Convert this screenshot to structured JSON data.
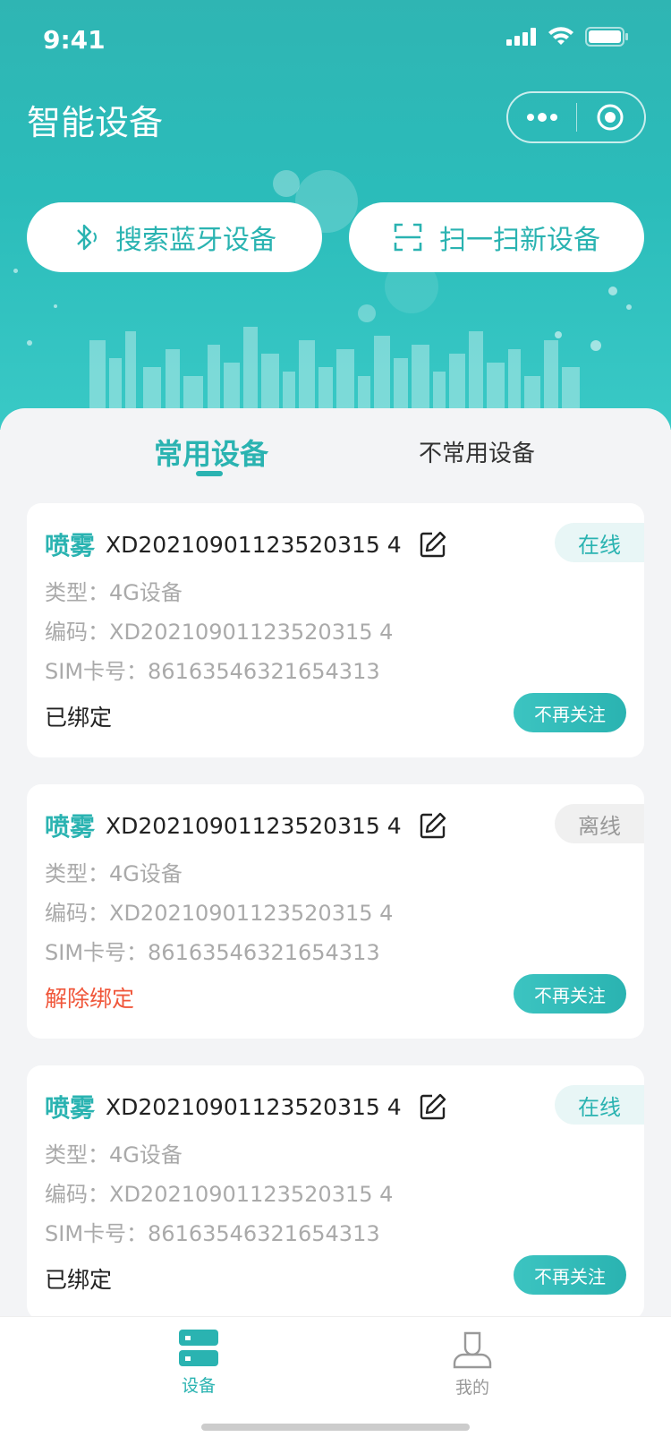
{
  "status_bar": {
    "time": "9:41"
  },
  "header": {
    "title": "智能设备"
  },
  "actions": {
    "bluetooth_label": "搜索蓝牙设备",
    "scan_label": "扫一扫新设备"
  },
  "tabs": [
    {
      "label": "常用设备",
      "active": true
    },
    {
      "label": "不常用设备",
      "active": false
    }
  ],
  "field_labels": {
    "type": "类型：",
    "code": "编码：",
    "sim": "SIM卡号："
  },
  "devices": [
    {
      "name": "喷雾",
      "id": "XD20210901123520315 4",
      "status": "在线",
      "type": "4G设备",
      "code": "XD20210901123520315 4",
      "sim": "86163546321654313",
      "bind_status": "已绑定",
      "action": "不再关注"
    },
    {
      "name": "喷雾",
      "id": "XD20210901123520315 4",
      "status": "离线",
      "type": "4G设备",
      "code": "XD20210901123520315 4",
      "sim": "86163546321654313",
      "bind_status": "解除绑定",
      "action": "不再关注"
    },
    {
      "name": "喷雾",
      "id": "XD20210901123520315 4",
      "status": "在线",
      "type": "4G设备",
      "code": "XD20210901123520315 4",
      "sim": "86163546321654313",
      "bind_status": "已绑定",
      "action": "不再关注"
    }
  ],
  "tabbar": [
    {
      "label": "设备",
      "icon": "device-icon",
      "active": true
    },
    {
      "label": "我的",
      "icon": "user-icon",
      "active": false
    }
  ],
  "colors": {
    "accent": "#2ab3b1",
    "danger": "#f0573b"
  }
}
